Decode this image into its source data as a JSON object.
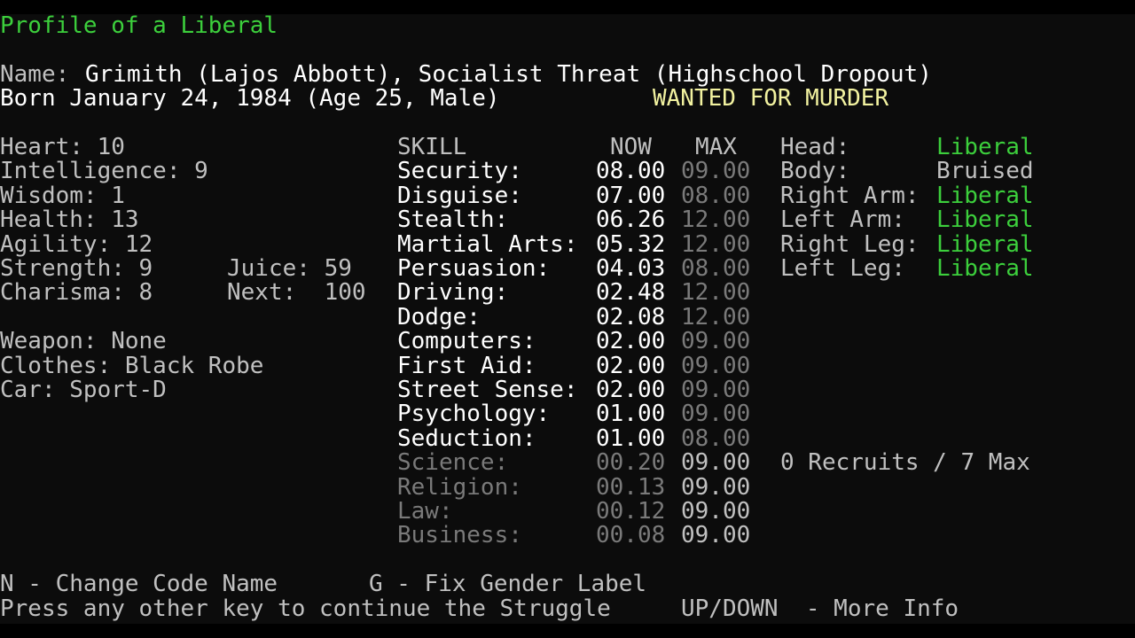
{
  "title": "Profile of a Liberal",
  "name_label": "Name:",
  "name_value": "Grimith (Lajos Abbott), Socialist Threat (Highschool Dropout)",
  "born_line": "Born January 24, 1984 (Age 25, Male)",
  "wanted": "WANTED FOR MURDER",
  "attributes": [
    {
      "text": "Heart: 10"
    },
    {
      "text": "Intelligence: 9"
    },
    {
      "text": "Wisdom: 1"
    },
    {
      "text": "Health: 13"
    },
    {
      "text": "Agility: 12"
    },
    {
      "text": "Strength: 9"
    },
    {
      "text": "Charisma: 8"
    }
  ],
  "juice": "Juice: 59",
  "next": "Next:  100",
  "weapon": "Weapon: None",
  "clothes": "Clothes: Black Robe",
  "car": "Car: Sport-D",
  "skills_header": {
    "skill": "SKILL",
    "now": "NOW",
    "max": "MAX"
  },
  "skills": [
    {
      "name": "Security:",
      "now": "08.00",
      "max": "09.00"
    },
    {
      "name": "Disguise:",
      "now": "07.00",
      "max": "08.00"
    },
    {
      "name": "Stealth:",
      "now": "06.26",
      "max": "12.00"
    },
    {
      "name": "Martial Arts:",
      "now": "05.32",
      "max": "12.00"
    },
    {
      "name": "Persuasion:",
      "now": "04.03",
      "max": "08.00"
    },
    {
      "name": "Driving:",
      "now": "02.48",
      "max": "12.00"
    },
    {
      "name": "Dodge:",
      "now": "02.08",
      "max": "12.00"
    },
    {
      "name": "Computers:",
      "now": "02.00",
      "max": "09.00"
    },
    {
      "name": "First Aid:",
      "now": "02.00",
      "max": "09.00"
    },
    {
      "name": "Street Sense:",
      "now": "02.00",
      "max": "09.00"
    },
    {
      "name": "Psychology:",
      "now": "01.00",
      "max": "09.00"
    },
    {
      "name": "Seduction:",
      "now": "01.00",
      "max": "08.00"
    },
    {
      "name": "Science:",
      "now": "00.20",
      "max": "09.00"
    },
    {
      "name": "Religion:",
      "now": "00.13",
      "max": "09.00"
    },
    {
      "name": "Law:",
      "now": "00.12",
      "max": "09.00"
    },
    {
      "name": "Business:",
      "now": "00.08",
      "max": "09.00"
    }
  ],
  "body_parts": [
    {
      "label": "Head:",
      "status": "Liberal"
    },
    {
      "label": "Body:",
      "status": "Bruised"
    },
    {
      "label": "Right Arm:",
      "status": "Liberal"
    },
    {
      "label": "Left Arm:",
      "status": "Liberal"
    },
    {
      "label": "Right Leg:",
      "status": "Liberal"
    },
    {
      "label": "Left Leg:",
      "status": "Liberal"
    }
  ],
  "recruits": "0 Recruits / 7 Max",
  "commands": {
    "change_name": "N - Change Code Name",
    "fix_gender": "G - Fix Gender Label",
    "continue": "Press any other key to continue the Struggle",
    "more_info": "UP/DOWN  - More Info"
  },
  "colors": {
    "background": "#0c0c0c",
    "green": "#3ccf3c",
    "yellow": "#f2f2a0",
    "white": "#ffffff",
    "light_gray": "#c0c0c0",
    "dark_gray": "#7a7a7a"
  }
}
